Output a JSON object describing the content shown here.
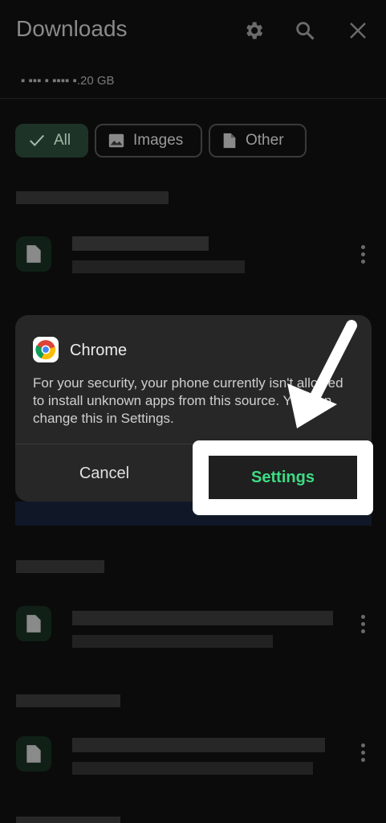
{
  "header": {
    "title": "Downloads",
    "storage_text": "▪ ▪▪▪ ▪ ▪▪▪▪ ▪.20 GB"
  },
  "chips": [
    {
      "label": "All",
      "icon": "check-icon",
      "active": true
    },
    {
      "label": "Images",
      "icon": "image-icon",
      "active": false
    },
    {
      "label": "Other",
      "icon": "document-icon",
      "active": false
    }
  ],
  "dialog": {
    "app_name": "Chrome",
    "app_icon": "chrome-icon",
    "message": "For your security, your phone currently isn't allowed to install unknown apps from this source. You can change this in Settings.",
    "cancel_label": "Cancel",
    "settings_label": "Settings"
  },
  "annotation": {
    "arrow_icon": "arrow-icon",
    "highlight_color": "#ffffff"
  },
  "colors": {
    "background": "#0b0b0b",
    "accent_green": "#3ddc84",
    "chip_active_bg": "#1d3327"
  }
}
